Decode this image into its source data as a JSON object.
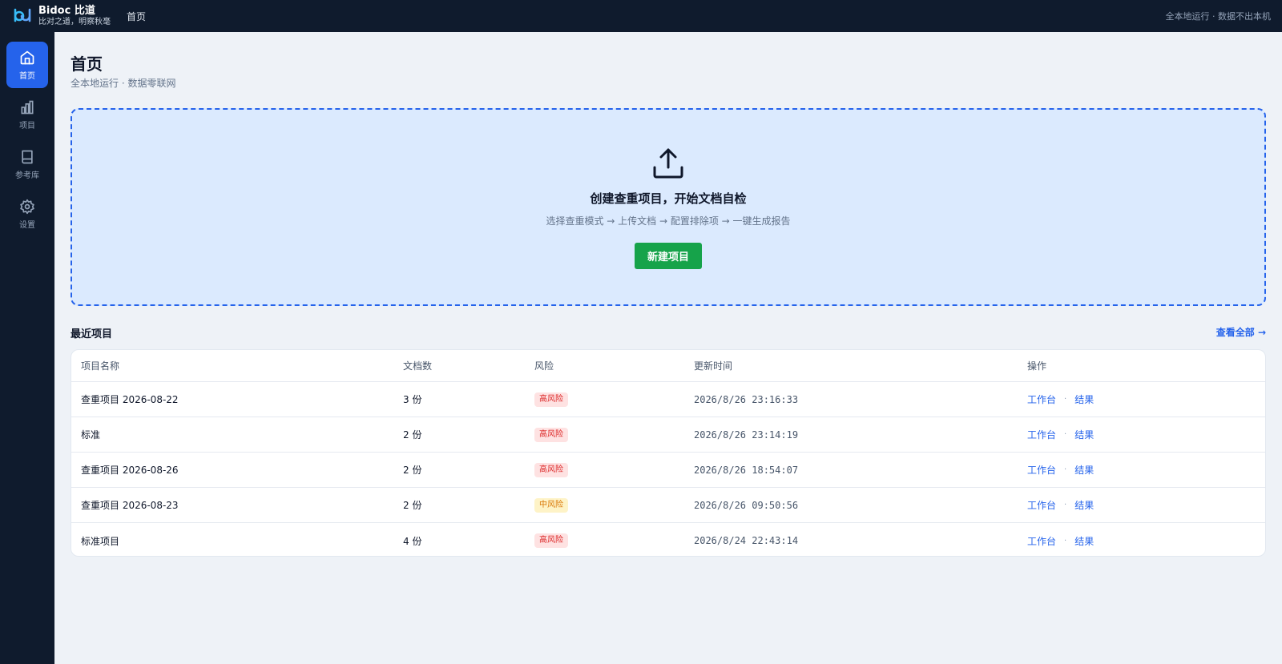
{
  "header": {
    "brand_name": "Bidoc 比道",
    "brand_tagline": "比对之道，明察秋毫",
    "breadcrumb": "首页",
    "status": "全本地运行 · 数据不出本机"
  },
  "sidebar": {
    "items": [
      {
        "label": "首页",
        "icon": "home-icon",
        "active": true
      },
      {
        "label": "项目",
        "icon": "bar-chart-icon",
        "active": false
      },
      {
        "label": "参考库",
        "icon": "book-icon",
        "active": false
      },
      {
        "label": "设置",
        "icon": "gear-icon",
        "active": false
      }
    ]
  },
  "page": {
    "title": "首页",
    "subtitle": "全本地运行 · 数据零联网"
  },
  "upload": {
    "icon": "upload-icon",
    "title": "创建查重项目，开始文档自检",
    "steps": "选择查重模式 → 上传文档 → 配置排除项 → 一键生成报告",
    "button": "新建项目"
  },
  "recent": {
    "title": "最近项目",
    "view_all": "查看全部 →",
    "columns": {
      "name": "项目名称",
      "docs": "文档数",
      "risk": "风险",
      "time": "更新时间",
      "ops": "操作"
    },
    "op_workbench": "工作台",
    "op_separator": "·",
    "op_result": "结果",
    "rows": [
      {
        "name": "查重项目 2026-08-22",
        "docs": "3 份",
        "risk": "高风险",
        "risk_level": "high",
        "time": "2026/8/26 23:16:33"
      },
      {
        "name": "标准",
        "docs": "2 份",
        "risk": "高风险",
        "risk_level": "high",
        "time": "2026/8/26 23:14:19"
      },
      {
        "name": "查重项目 2026-08-26",
        "docs": "2 份",
        "risk": "高风险",
        "risk_level": "high",
        "time": "2026/8/26 18:54:07"
      },
      {
        "name": "查重项目 2026-08-23",
        "docs": "2 份",
        "risk": "中风险",
        "risk_level": "mid",
        "time": "2026/8/26 09:50:56"
      },
      {
        "name": "标准项目",
        "docs": "4 份",
        "risk": "高风险",
        "risk_level": "high",
        "time": "2026/8/24 22:43:14"
      }
    ]
  },
  "colors": {
    "topbar": "#0f1b2d",
    "accent": "#2563eb",
    "primary_button": "#16a34a",
    "risk_high": "#dc2626",
    "risk_mid": "#d97706"
  }
}
